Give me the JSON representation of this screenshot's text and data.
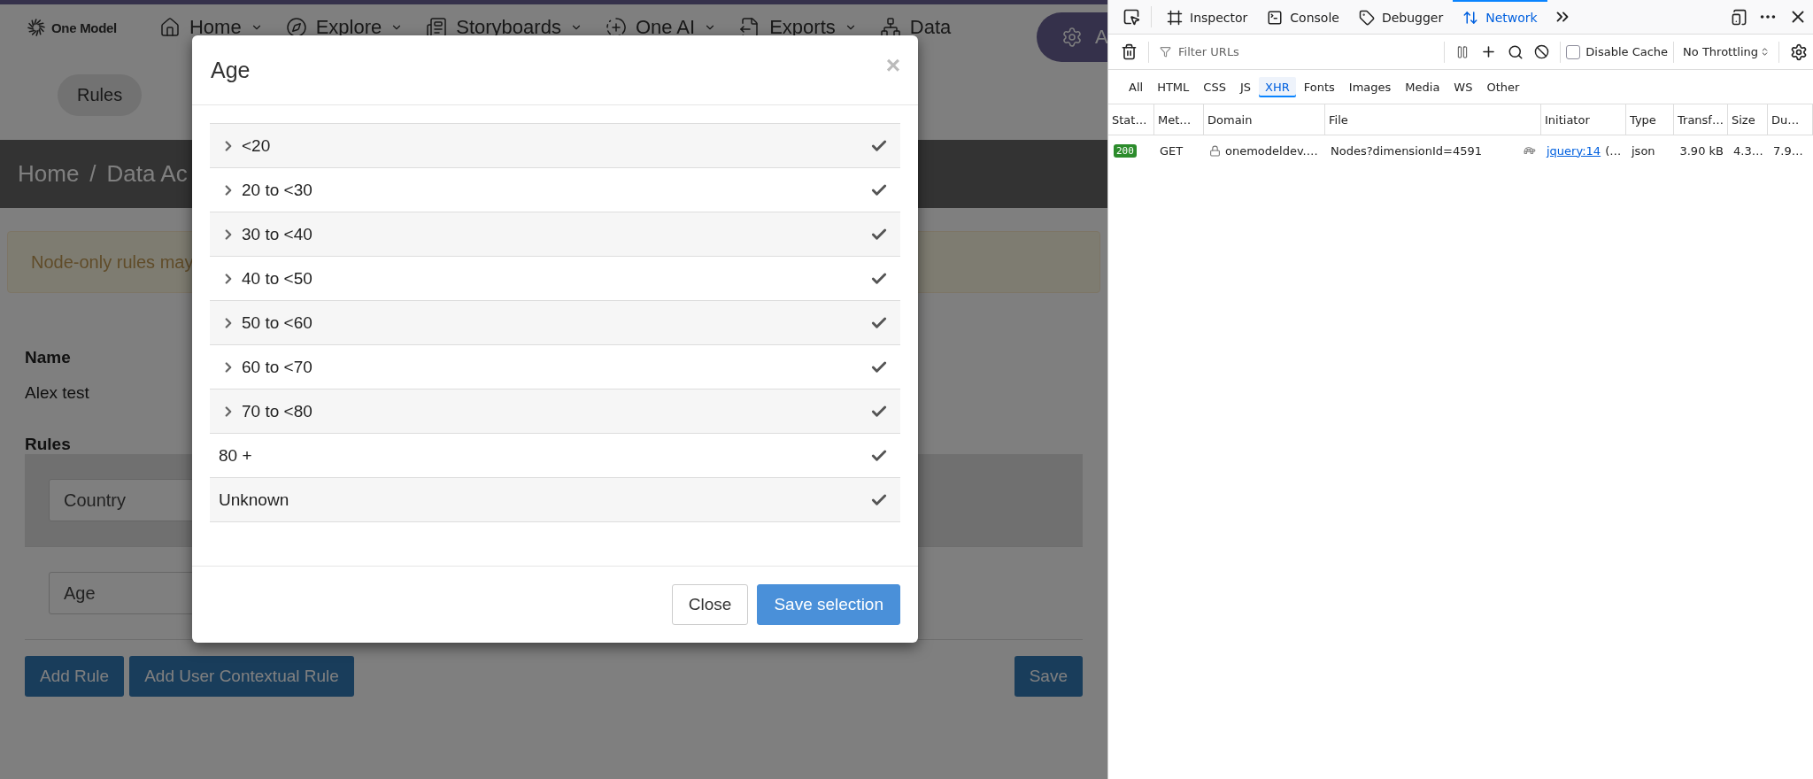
{
  "nav": {
    "logo": "One Model",
    "items": [
      {
        "label": "Home",
        "kind": "home",
        "menu": true
      },
      {
        "label": "Explore",
        "kind": "explore",
        "menu": true
      },
      {
        "label": "Storyboards",
        "kind": "storyboards",
        "menu": true
      },
      {
        "label": "One AI",
        "kind": "ai",
        "menu": true
      },
      {
        "label": "Exports",
        "kind": "exports",
        "menu": true
      },
      {
        "label": "Data",
        "kind": "data",
        "menu": false
      }
    ],
    "admin_button": "A"
  },
  "subnav": {
    "tabs": [
      {
        "label": "Rules",
        "selected": true
      }
    ]
  },
  "breadcrumb": [
    "Home",
    "Data Ac"
  ],
  "breadcrumb_separator": "/",
  "alert": "Node-only rules may",
  "form": {
    "name_label": "Name",
    "name_value": "Alex test",
    "rules_label": "Rules",
    "rules": [
      {
        "value": "Country",
        "active": true
      },
      {
        "value": "Age",
        "active": false
      }
    ],
    "buttons": [
      "Add Rule",
      "Add User Contextual Rule"
    ],
    "save": "Save"
  },
  "modal": {
    "title": "Age",
    "close": "×",
    "items": [
      {
        "label": "<20",
        "expandable": true,
        "checked": true
      },
      {
        "label": "20 to <30",
        "expandable": true,
        "checked": true
      },
      {
        "label": "30 to <40",
        "expandable": true,
        "checked": true
      },
      {
        "label": "40 to <50",
        "expandable": true,
        "checked": true
      },
      {
        "label": "50 to <60",
        "expandable": true,
        "checked": true
      },
      {
        "label": "60 to <70",
        "expandable": true,
        "checked": true
      },
      {
        "label": "70 to <80",
        "expandable": true,
        "checked": true
      },
      {
        "label": "80 +",
        "expandable": false,
        "checked": true
      },
      {
        "label": "Unknown",
        "expandable": false,
        "checked": true
      }
    ],
    "buttons": [
      {
        "label": "Close",
        "kind": "secondary"
      },
      {
        "label": "Save selection",
        "kind": "primary"
      }
    ]
  },
  "devtools": {
    "tabs": [
      {
        "label": "Inspector",
        "kind": "inspector",
        "selected": false
      },
      {
        "label": "Console",
        "kind": "console",
        "selected": false
      },
      {
        "label": "Debugger",
        "kind": "debugger",
        "selected": false
      },
      {
        "label": "Network",
        "kind": "network",
        "selected": true
      }
    ],
    "filter_placeholder": "Filter URLs",
    "disable_cache": {
      "label": "Disable Cache",
      "checked": false
    },
    "throttling": "No Throttling",
    "type_filters": [
      {
        "label": "All",
        "selected": false
      },
      {
        "label": "HTML",
        "selected": false
      },
      {
        "label": "CSS",
        "selected": false
      },
      {
        "label": "JS",
        "selected": false
      },
      {
        "label": "XHR",
        "selected": true
      },
      {
        "label": "Fonts",
        "selected": false
      },
      {
        "label": "Images",
        "selected": false
      },
      {
        "label": "Media",
        "selected": false
      },
      {
        "label": "WS",
        "selected": false
      },
      {
        "label": "Other",
        "selected": false
      }
    ],
    "columns": [
      "Stat…",
      "Met…",
      "Domain",
      "File",
      "Initiator",
      "Type",
      "Transf…",
      "Size",
      "Du…"
    ],
    "rows": [
      {
        "status": "200",
        "method": "GET",
        "domain": "onemodeldev.…",
        "file": "Nodes?dimensionId=4591",
        "initiator_link": "jquery:14",
        "initiator_rest": "(…",
        "type": "json",
        "transferred": "3.90 kB",
        "size": "4.3…",
        "duration": "7.9…"
      }
    ]
  }
}
